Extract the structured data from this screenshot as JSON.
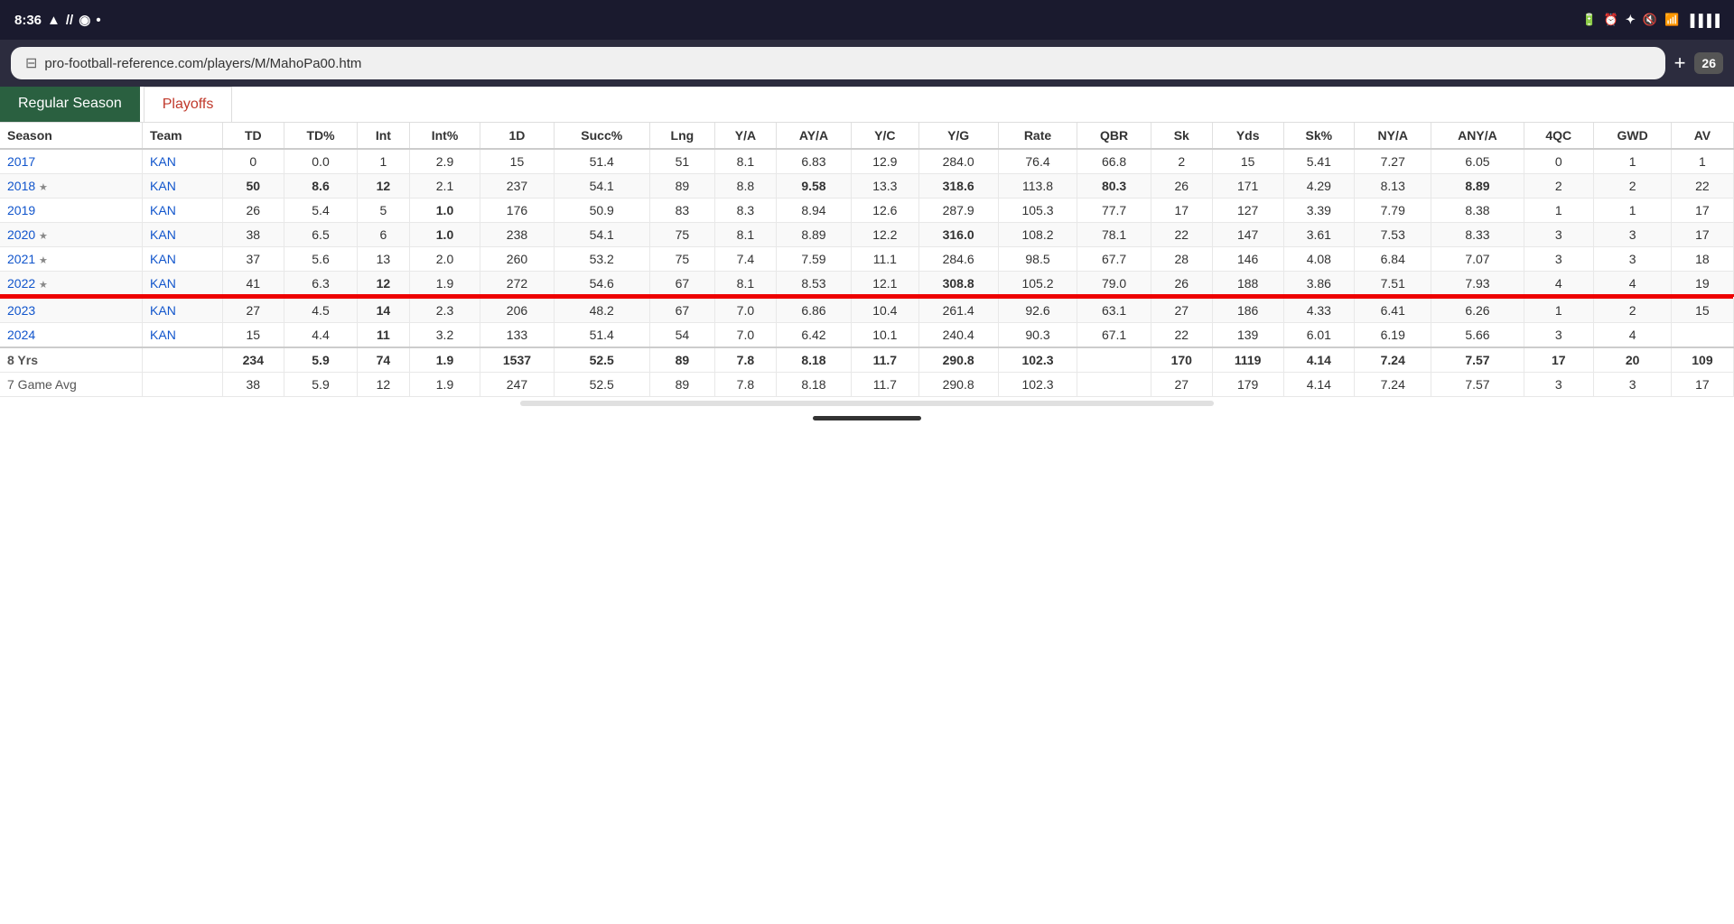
{
  "statusBar": {
    "time": "8:36",
    "icons": [
      "signal",
      "wifi-calling",
      "notification",
      "dot"
    ],
    "rightIcons": [
      "battery",
      "alarm",
      "bluetooth",
      "mute",
      "wifi",
      "cellular"
    ],
    "tabCount": "26"
  },
  "urlBar": {
    "url": "pro-football-reference.com/players/M/MahoPa00.htm",
    "plus": "+",
    "tabs": "26"
  },
  "tabs": [
    {
      "label": "Regular Season",
      "active": true
    },
    {
      "label": "Playoffs",
      "active": false
    }
  ],
  "tableHeaders": [
    "Season",
    "Team",
    "TD",
    "TD%",
    "Int",
    "Int%",
    "1D",
    "Succ%",
    "Lng",
    "Y/A",
    "AY/A",
    "Y/C",
    "Y/G",
    "Rate",
    "QBR",
    "Sk",
    "Yds",
    "Sk%",
    "NY/A",
    "ANY/A",
    "4QC",
    "GWD",
    "AV"
  ],
  "rows": [
    {
      "season": "2017",
      "star": false,
      "team": "KAN",
      "td": 0,
      "td_pct": "0.0",
      "int": 1,
      "int_pct": "2.9",
      "onD": 15,
      "succ": "51.4",
      "lng": 51,
      "ya": "8.1",
      "aya": "6.83",
      "yc": "12.9",
      "yg": "284.0",
      "rate": "76.4",
      "qbr": "66.8",
      "sk": 2,
      "yds": 15,
      "sk_pct": "5.41",
      "nya": "7.27",
      "anya": "6.05",
      "fourQC": 0,
      "gwd": 1,
      "av": 1,
      "highlight_row": false
    },
    {
      "season": "2018",
      "star": true,
      "team": "KAN",
      "td": 50,
      "td_pct": "8.6",
      "int": 12,
      "int_pct": "2.1",
      "onD": 237,
      "succ": "54.1",
      "lng": 89,
      "ya": "8.8",
      "aya": "9.58",
      "yc": "13.3",
      "yg": "318.6",
      "rate": "113.8",
      "qbr": "80.3",
      "sk": 26,
      "yds": 171,
      "sk_pct": "4.29",
      "nya": "8.13",
      "anya": "8.89",
      "fourQC": 2,
      "gwd": 2,
      "av": 22,
      "highlight_row": false
    },
    {
      "season": "2019",
      "star": false,
      "team": "KAN",
      "td": 26,
      "td_pct": "5.4",
      "int": 5,
      "int_pct": "1.0",
      "onD": 176,
      "succ": "50.9",
      "lng": 83,
      "ya": "8.3",
      "aya": "8.94",
      "yc": "12.6",
      "yg": "287.9",
      "rate": "105.3",
      "qbr": "77.7",
      "sk": 17,
      "yds": 127,
      "sk_pct": "3.39",
      "nya": "7.79",
      "anya": "8.38",
      "fourQC": 1,
      "gwd": 1,
      "av": 17,
      "highlight_row": false
    },
    {
      "season": "2020",
      "star": true,
      "team": "KAN",
      "td": 38,
      "td_pct": "6.5",
      "int": 6,
      "int_pct": "1.0",
      "onD": 238,
      "succ": "54.1",
      "lng": 75,
      "ya": "8.1",
      "aya": "8.89",
      "yc": "12.2",
      "yg": "316.0",
      "rate": "108.2",
      "qbr": "78.1",
      "sk": 22,
      "yds": 147,
      "sk_pct": "3.61",
      "nya": "7.53",
      "anya": "8.33",
      "fourQC": 3,
      "gwd": 3,
      "av": 17,
      "highlight_row": false
    },
    {
      "season": "2021",
      "star": true,
      "team": "KAN",
      "td": 37,
      "td_pct": "5.6",
      "int": 13,
      "int_pct": "2.0",
      "onD": 260,
      "succ": "53.2",
      "lng": 75,
      "ya": "7.4",
      "aya": "7.59",
      "yc": "11.1",
      "yg": "284.6",
      "rate": "98.5",
      "qbr": "67.7",
      "sk": 28,
      "yds": 146,
      "sk_pct": "4.08",
      "nya": "6.84",
      "anya": "7.07",
      "fourQC": 3,
      "gwd": 3,
      "av": 18,
      "highlight_row": false
    },
    {
      "season": "2022",
      "star": true,
      "team": "KAN",
      "td": 41,
      "td_pct": "6.3",
      "int": 12,
      "int_pct": "1.9",
      "onD": 272,
      "succ": "54.6",
      "lng": 67,
      "ya": "8.1",
      "aya": "8.53",
      "yc": "12.1",
      "yg": "308.8",
      "rate": "105.2",
      "qbr": "79.0",
      "sk": 26,
      "yds": 188,
      "sk_pct": "3.86",
      "nya": "7.51",
      "anya": "7.93",
      "fourQC": 4,
      "gwd": 4,
      "av": 19,
      "highlight_row": true
    },
    {
      "season": "2023",
      "star": false,
      "team": "KAN",
      "td": 27,
      "td_pct": "4.5",
      "int": 14,
      "int_pct": "2.3",
      "onD": 206,
      "succ": "48.2",
      "lng": 67,
      "ya": "7.0",
      "aya": "6.86",
      "yc": "10.4",
      "yg": "261.4",
      "rate": "92.6",
      "qbr": "63.1",
      "sk": 27,
      "yds": 186,
      "sk_pct": "4.33",
      "nya": "6.41",
      "anya": "6.26",
      "fourQC": 1,
      "gwd": 2,
      "av": 15,
      "highlight_row": false
    },
    {
      "season": "2024",
      "star": false,
      "team": "KAN",
      "td": 15,
      "td_pct": "4.4",
      "int": 11,
      "int_pct": "3.2",
      "onD": 133,
      "succ": "51.4",
      "lng": 54,
      "ya": "7.0",
      "aya": "6.42",
      "yc": "10.1",
      "yg": "240.4",
      "rate": "90.3",
      "qbr": "67.1",
      "sk": 22,
      "yds": 139,
      "sk_pct": "6.01",
      "nya": "6.19",
      "anya": "5.66",
      "fourQC": 3,
      "gwd": 4,
      "av": "",
      "highlight_row": false
    }
  ],
  "totalsRow": {
    "label": "8 Yrs",
    "td": 234,
    "td_pct": "5.9",
    "int": 74,
    "int_pct": "1.9",
    "onD": 1537,
    "succ": "52.5",
    "lng": 89,
    "ya": "7.8",
    "aya": "8.18",
    "yc": "11.7",
    "yg": "290.8",
    "rate": "102.3",
    "qbr": "",
    "sk": 170,
    "yds": 1119,
    "sk_pct": "4.14",
    "nya": "7.24",
    "anya": "7.57",
    "fourQC": 17,
    "gwd": 20,
    "av": 109
  },
  "avgRow": {
    "label": "7 Game Avg",
    "td": 38,
    "td_pct": "5.9",
    "int": 12,
    "int_pct": "1.9",
    "onD": 247,
    "succ": "52.5",
    "lng": 89,
    "ya": "7.8",
    "aya": "8.18",
    "yc": "11.7",
    "yg": "290.8",
    "rate": "102.3",
    "qbr": "",
    "sk": 27,
    "yds": 179,
    "sk_pct": "4.14",
    "nya": "7.24",
    "anya": "7.57",
    "fourQC": 3,
    "gwd": 3,
    "av": 17
  }
}
